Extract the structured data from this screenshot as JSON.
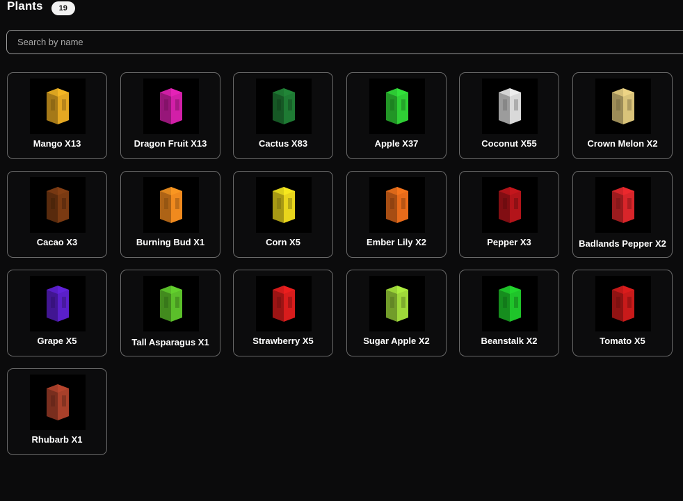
{
  "header": {
    "title": "Plants",
    "count": "19"
  },
  "search": {
    "placeholder": "Search by name"
  },
  "plants": [
    {
      "label": "Mango X13",
      "icon": "mango-icon",
      "color": "#e5a822"
    },
    {
      "label": "Dragon Fruit X13",
      "icon": "dragon-fruit-icon",
      "color": "#d21fa8"
    },
    {
      "label": "Cactus X83",
      "icon": "cactus-icon",
      "color": "#1e7a33"
    },
    {
      "label": "Apple X37",
      "icon": "apple-icon",
      "color": "#2fcf35"
    },
    {
      "label": "Coconut X55",
      "icon": "coconut-icon",
      "color": "#d9d9d9"
    },
    {
      "label": "Crown Melon X2",
      "icon": "crown-melon-icon",
      "color": "#d9c37a"
    },
    {
      "label": "Cacao X3",
      "icon": "cacao-icon",
      "color": "#7a3a12"
    },
    {
      "label": "Burning Bud X1",
      "icon": "burning-bud-icon",
      "color": "#f08a1e"
    },
    {
      "label": "Corn X5",
      "icon": "corn-icon",
      "color": "#e8d51c"
    },
    {
      "label": "Ember Lily X2",
      "icon": "ember-lily-icon",
      "color": "#e86b1a"
    },
    {
      "label": "Pepper X3",
      "icon": "pepper-icon",
      "color": "#b3141a"
    },
    {
      "label": "Badlands Pepper X2",
      "icon": "badlands-pepper-icon",
      "color": "#d8252a"
    },
    {
      "label": "Grape X5",
      "icon": "grape-icon",
      "color": "#5a1fc9"
    },
    {
      "label": "Tall Asparagus X1",
      "icon": "tall-asparagus-icon",
      "color": "#5bbf2a"
    },
    {
      "label": "Strawberry X5",
      "icon": "strawberry-icon",
      "color": "#d81c1c"
    },
    {
      "label": "Sugar Apple X2",
      "icon": "sugar-apple-icon",
      "color": "#9fd93a"
    },
    {
      "label": "Beanstalk X2",
      "icon": "beanstalk-icon",
      "color": "#1fc42a"
    },
    {
      "label": "Tomato X5",
      "icon": "tomato-icon",
      "color": "#c81a1a"
    },
    {
      "label": "Rhubarb X1",
      "icon": "rhubarb-icon",
      "color": "#a8402a"
    }
  ]
}
